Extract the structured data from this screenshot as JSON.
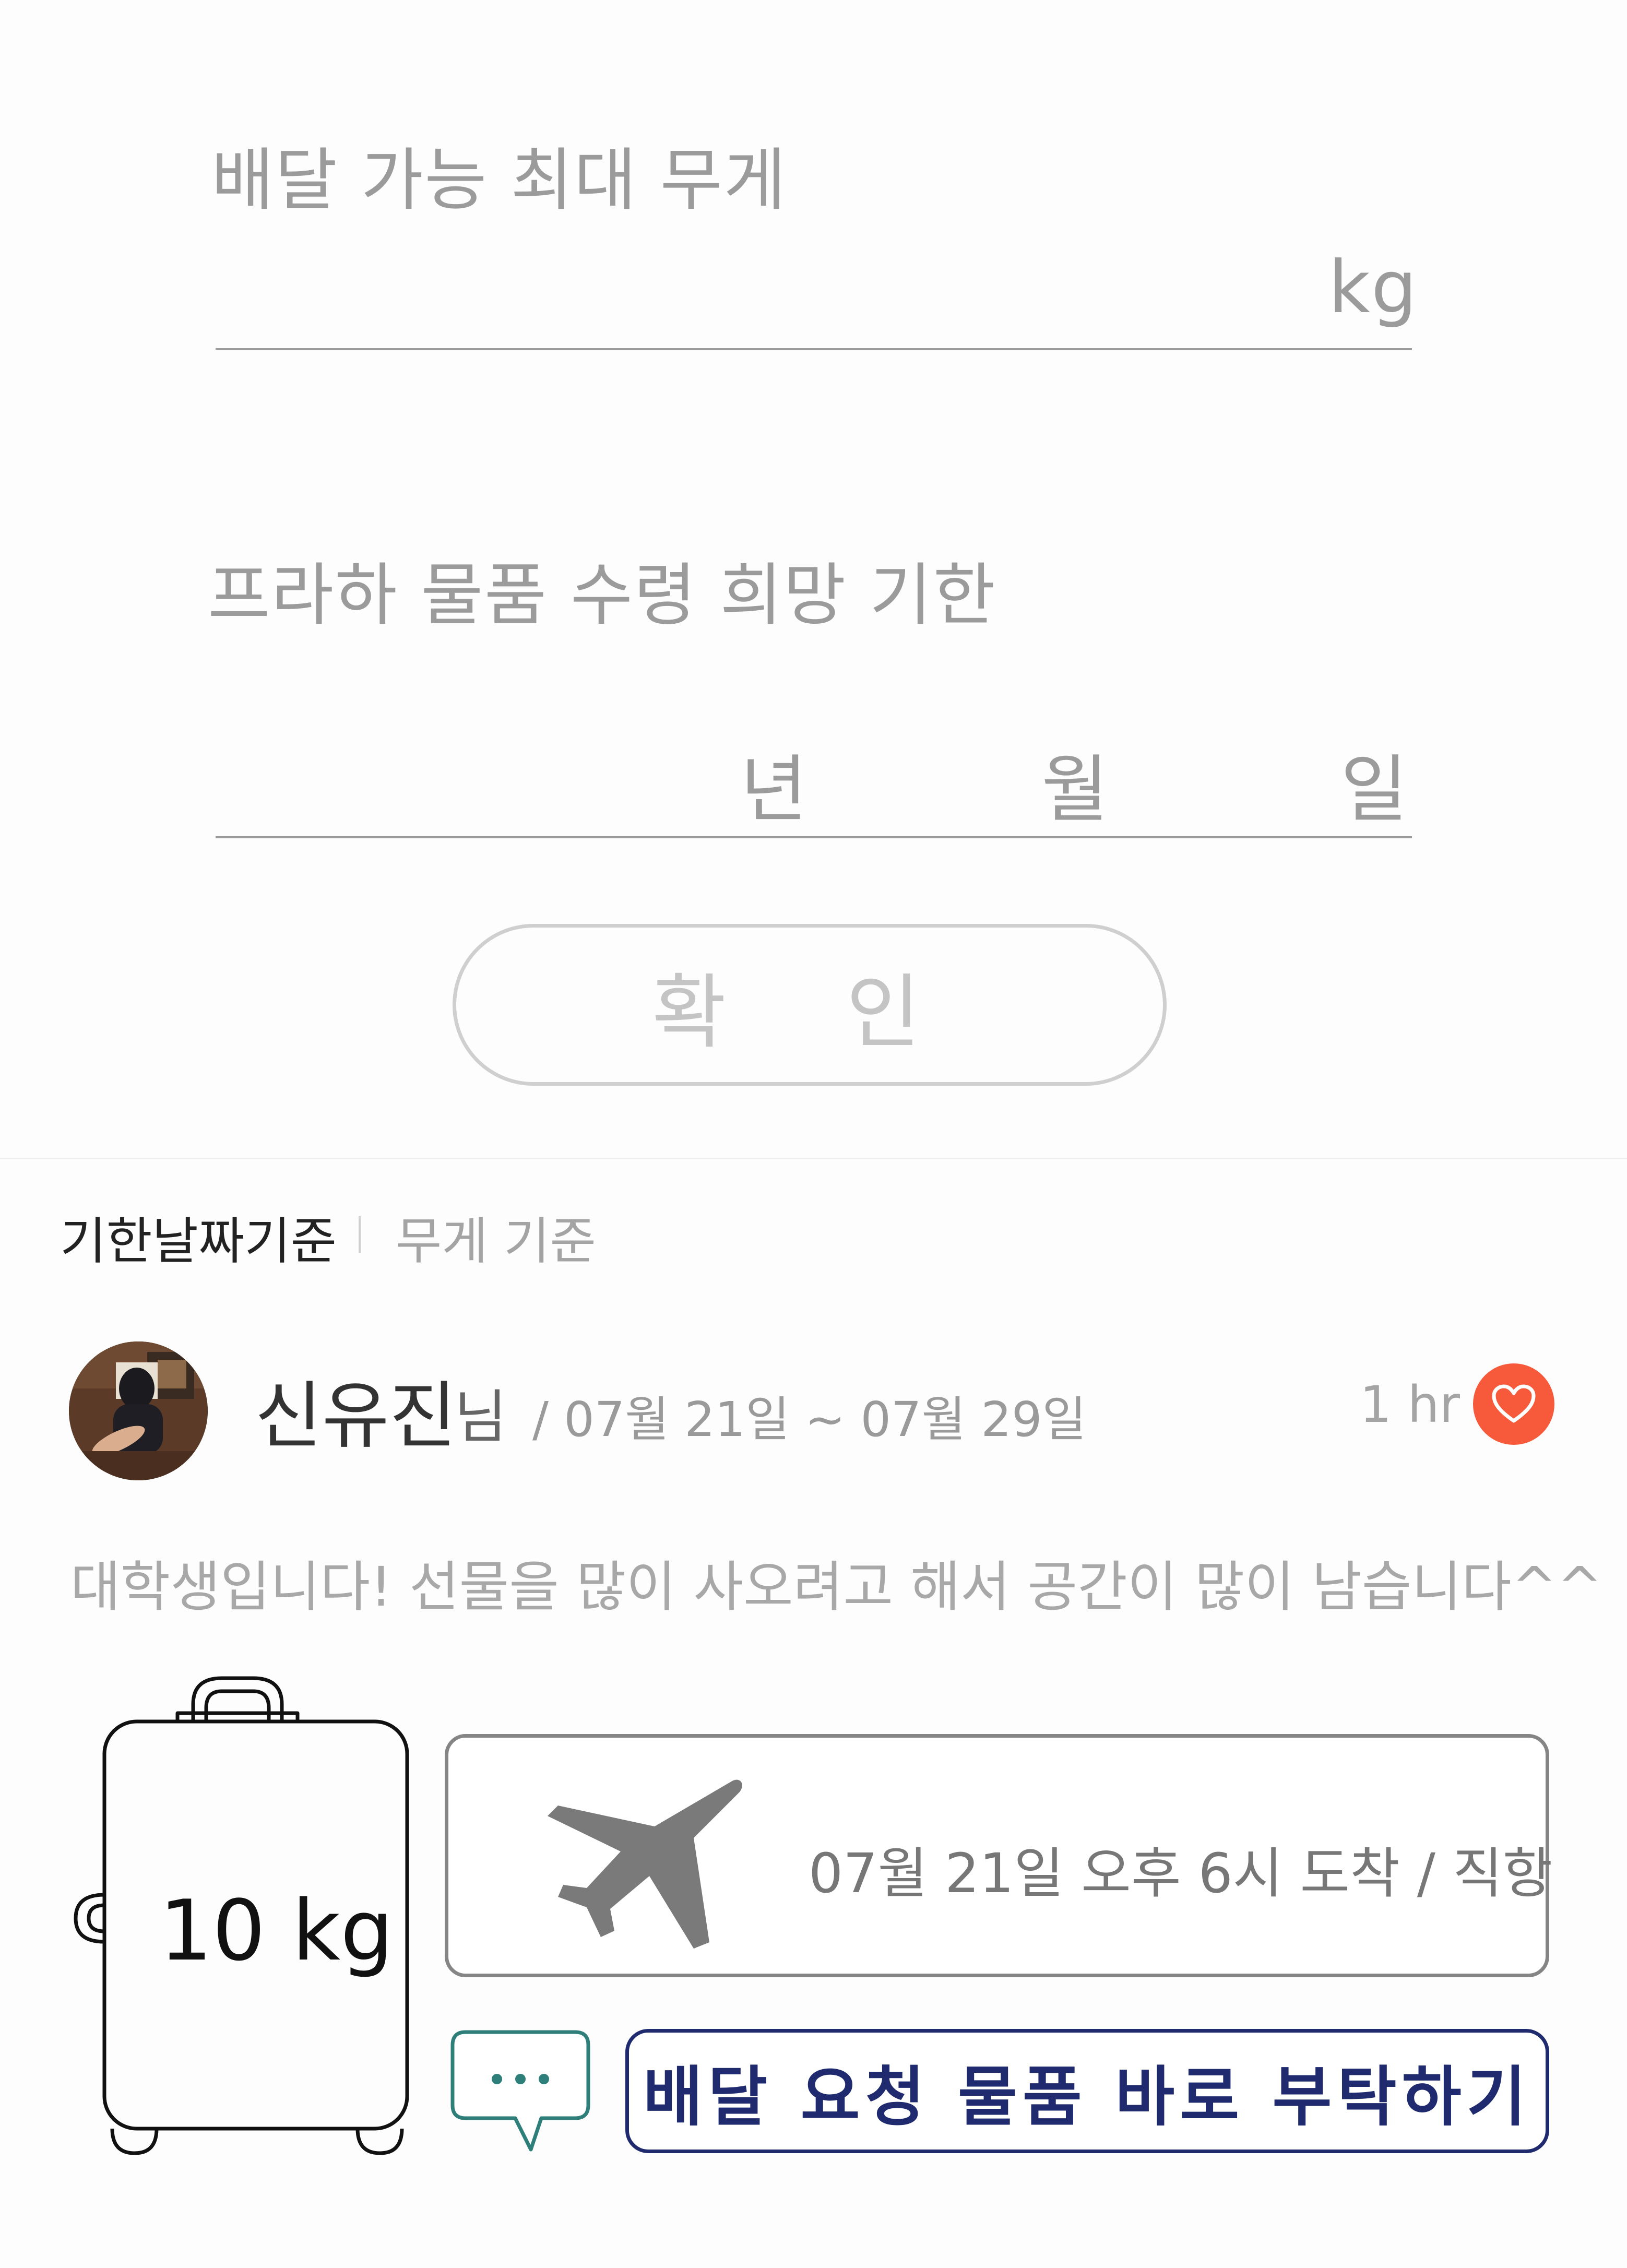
{
  "form": {
    "weight_label": "배달 가능 최대 무게",
    "weight_unit": "kg",
    "deadline_label": "프라하 물품 수령 희망 기한",
    "year_unit": "년",
    "month_unit": "월",
    "day_unit": "일",
    "confirm_label": "확 인"
  },
  "sort": {
    "active": "기한날짜기준",
    "inactive": "무게 기준"
  },
  "post": {
    "name": "신유진",
    "honorific": "님",
    "date_range": "/ 07월 21일 ~ 07월 29일",
    "time_ago": "1 hr",
    "description": "대학생입니다! 선물을 많이 사오려고 해서 공간이 많이 남습니다^^",
    "luggage_weight": "10 kg",
    "flight_info": "07월 21일 오후 6시 도착 / 직항",
    "request_button": "배달 요청 물품 바로 부탁하기"
  },
  "colors": {
    "heart": "#f65a3a",
    "request_button": "#1f2b6e",
    "chat_icon": "#2e7f7a"
  },
  "icons": [
    "heart-icon",
    "airplane-icon",
    "chat-icon",
    "luggage-icon"
  ]
}
